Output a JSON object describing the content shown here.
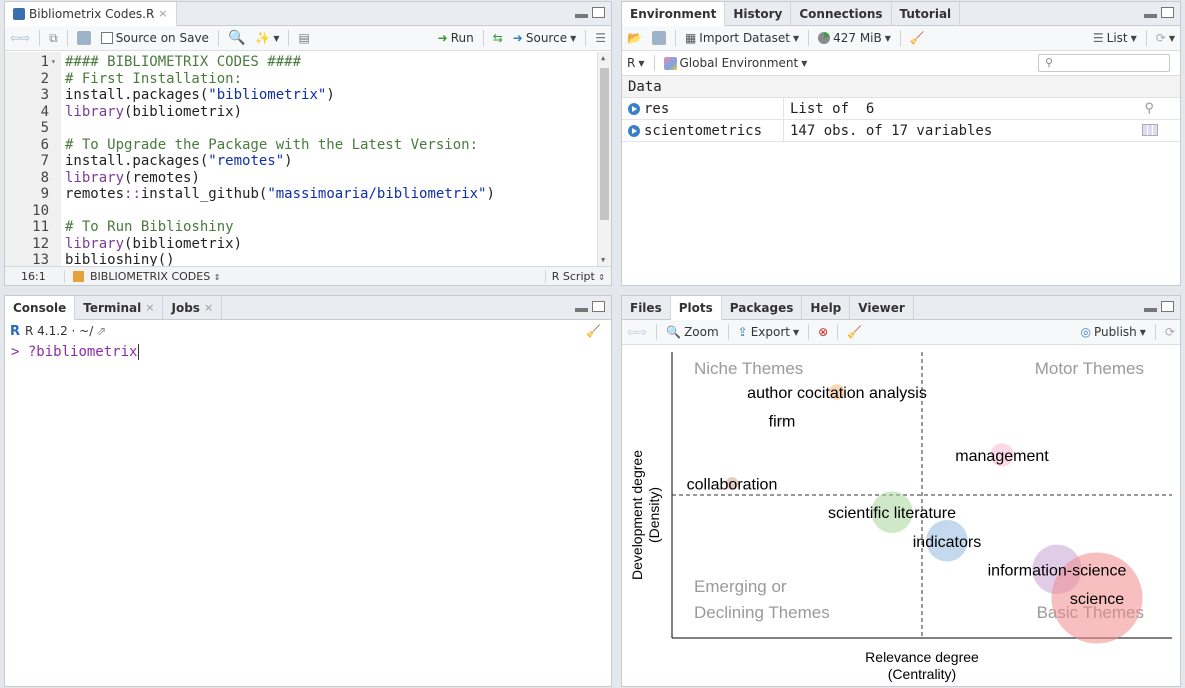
{
  "source": {
    "tab": "Bibliometrix Codes.R",
    "source_on_save": "Source on Save",
    "run": "Run",
    "source_btn": "Source",
    "lines": [
      {
        "n": "1",
        "segs": [
          {
            "t": "#### BIBLIOMETRIX CODES ####",
            "c": "comment"
          }
        ],
        "fold": "▾"
      },
      {
        "n": "2",
        "segs": [
          {
            "t": "# First Installation:",
            "c": "comment"
          }
        ]
      },
      {
        "n": "3",
        "segs": [
          {
            "t": "install.packages(",
            "c": ""
          },
          {
            "t": "\"bibliometrix\"",
            "c": "string"
          },
          {
            "t": ")",
            "c": ""
          }
        ]
      },
      {
        "n": "4",
        "segs": [
          {
            "t": "library",
            "c": "kw"
          },
          {
            "t": "(bibliometrix)",
            "c": ""
          }
        ]
      },
      {
        "n": "5",
        "segs": []
      },
      {
        "n": "6",
        "segs": [
          {
            "t": "# To Upgrade the Package with the Latest Version:",
            "c": "comment"
          }
        ]
      },
      {
        "n": "7",
        "segs": [
          {
            "t": "install.packages(",
            "c": ""
          },
          {
            "t": "\"remotes\"",
            "c": "string"
          },
          {
            "t": ")",
            "c": ""
          }
        ]
      },
      {
        "n": "8",
        "segs": [
          {
            "t": "library",
            "c": "kw"
          },
          {
            "t": "(remotes)",
            "c": ""
          }
        ]
      },
      {
        "n": "9",
        "segs": [
          {
            "t": "remotes",
            "c": ""
          },
          {
            "t": "::",
            "c": "kw"
          },
          {
            "t": "install_github(",
            "c": ""
          },
          {
            "t": "\"massimoaria/bibliometrix\"",
            "c": "string"
          },
          {
            "t": ")",
            "c": ""
          }
        ]
      },
      {
        "n": "10",
        "segs": []
      },
      {
        "n": "11",
        "segs": [
          {
            "t": "# To Run Biblioshiny",
            "c": "comment"
          }
        ]
      },
      {
        "n": "12",
        "segs": [
          {
            "t": "library",
            "c": "kw"
          },
          {
            "t": "(bibliometrix)",
            "c": ""
          }
        ]
      },
      {
        "n": "13",
        "segs": [
          {
            "t": "biblioshiny()",
            "c": ""
          }
        ]
      }
    ],
    "status_pos": "16:1",
    "status_section": "BIBLIOMETRIX CODES",
    "status_type": "R Script"
  },
  "env": {
    "tabs": [
      "Environment",
      "History",
      "Connections",
      "Tutorial"
    ],
    "import_dataset": "Import Dataset",
    "memory": "427 MiB",
    "list_view": "List",
    "r_lang": "R",
    "global_env": "Global Environment",
    "section": "Data",
    "rows": [
      {
        "name": "res",
        "value": "List of  6"
      },
      {
        "name": "scientometrics",
        "value": "147 obs. of 17 variables"
      }
    ]
  },
  "console": {
    "tabs": [
      {
        "label": "Console",
        "close": ""
      },
      {
        "label": "Terminal",
        "close": "×"
      },
      {
        "label": "Jobs",
        "close": "×"
      }
    ],
    "version": "R 4.1.2 · ~/",
    "prompt": ">",
    "command": "?bibliometrix"
  },
  "viewer": {
    "tabs": [
      "Files",
      "Plots",
      "Packages",
      "Help",
      "Viewer"
    ],
    "zoom": "Zoom",
    "export": "Export",
    "publish": "Publish"
  },
  "chart_data": {
    "type": "scatter",
    "xlabel": "Relevance degree\n(Centrality)",
    "ylabel": "Development degree\n(Density)",
    "quadrant_labels": [
      "Niche Themes",
      "Motor Themes",
      "Emerging or\nDeclining Themes",
      "Basic Themes"
    ],
    "points": [
      {
        "label": "author cocitation analysis",
        "x": 0.33,
        "y": 0.86,
        "r": 0.6,
        "color": "#f6b47a"
      },
      {
        "label": "firm",
        "x": 0.22,
        "y": 0.76,
        "r": 0.3,
        "color": "#d8d8d8"
      },
      {
        "label": "management",
        "x": 0.66,
        "y": 0.64,
        "r": 0.9,
        "color": "#f5b8d2"
      },
      {
        "label": "collaboration",
        "x": 0.12,
        "y": 0.54,
        "r": 0.5,
        "color": "#d4a590"
      },
      {
        "label": "scientific literature",
        "x": 0.44,
        "y": 0.44,
        "r": 1.6,
        "color": "#a8d79a"
      },
      {
        "label": "indicators",
        "x": 0.55,
        "y": 0.34,
        "r": 1.6,
        "color": "#93b9e0"
      },
      {
        "label": "information-science",
        "x": 0.77,
        "y": 0.24,
        "r": 1.9,
        "color": "#c9a3d6"
      },
      {
        "label": "science",
        "x": 0.85,
        "y": 0.14,
        "r": 3.5,
        "color": "#f08a8a"
      }
    ],
    "xdivider": 0.5,
    "ydivider": 0.5
  }
}
